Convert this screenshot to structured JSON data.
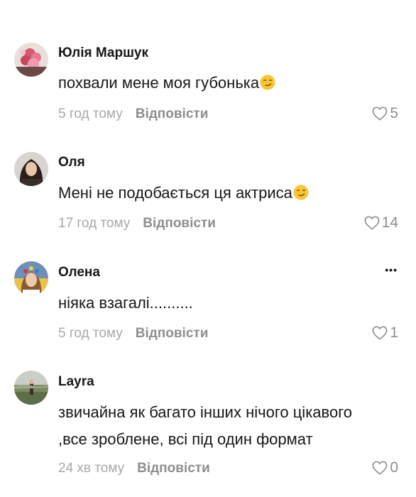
{
  "comments": [
    {
      "username": "Юлія Маршук",
      "text": "похвали мене моя губонька",
      "emoji": "smirk-emoji",
      "time": "5 год тому",
      "reply_label": "Відповісти",
      "likes": "5"
    },
    {
      "username": "Оля",
      "text": "Мені не подобається ця актриса",
      "emoji": "smirk-emoji",
      "time": "17 год тому",
      "reply_label": "Відповісти",
      "likes": "14"
    },
    {
      "username": "Олена",
      "text": "ніяка взагалі..........",
      "time": "5 год тому",
      "reply_label": "Відповісти",
      "likes": "1",
      "more_label": "•••"
    },
    {
      "username": "Layra",
      "text_line1": "звичайна як багато інших нічого цікавого",
      "text_line2": ",все зроблене, всі під один формат",
      "time": "24 хв тому",
      "reply_label": "Відповісти",
      "likes": "0"
    }
  ],
  "colors": {
    "text": "#161616",
    "meta": "#a8a8a8",
    "action": "#8e8e8e"
  }
}
